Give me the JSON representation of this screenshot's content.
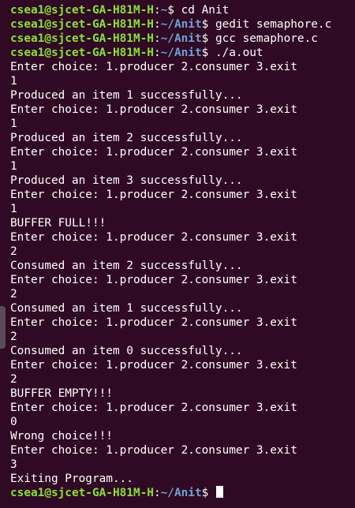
{
  "terminal": {
    "user_host": "csea1@sjcet-GA-H81M-H",
    "colors": {
      "background": "#300a24",
      "user": "#8ae234",
      "path": "#729fcf",
      "text": "#ffffff"
    },
    "prompts": [
      {
        "path": "~",
        "command": " cd Anit"
      },
      {
        "path": "~/Anit",
        "command": " gedit semaphore.c"
      },
      {
        "path": "~/Anit",
        "command": " gcc semaphore.c"
      },
      {
        "path": "~/Anit",
        "command": " ./a.out"
      }
    ],
    "menu": "Enter choice: 1.producer 2.consumer 3.exit",
    "output": [
      "1",
      "Produced an item 1 successfully...",
      "1",
      "Produced an item 2 successfully...",
      "1",
      "Produced an item 3 successfully...",
      "1",
      "BUFFER FULL!!!",
      "2",
      "Consumed an item 2 successfully...",
      "2",
      "Consumed an item 1 successfully...",
      "2",
      "Consumed an item 0 successfully...",
      "2",
      "BUFFER EMPTY!!!",
      "0",
      "Wrong choice!!!",
      "3",
      "Exiting Program..."
    ],
    "final_prompt": {
      "path": "~/Anit"
    }
  }
}
